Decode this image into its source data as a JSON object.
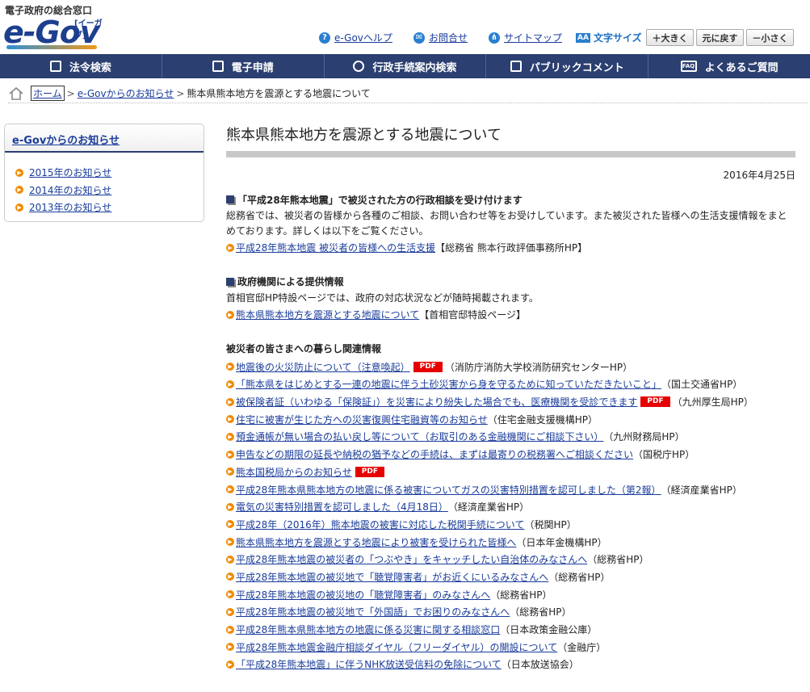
{
  "header": {
    "tagline": "電子政府の総合窓口",
    "logo_text": "e-Gov",
    "logo_kana": "[イーガブ]",
    "util_links": [
      {
        "label": "e-Govヘルプ",
        "icon": "question-icon"
      },
      {
        "label": "お問合せ",
        "icon": "mail-icon"
      },
      {
        "label": "サイトマップ",
        "icon": "sitemap-icon"
      }
    ],
    "font_size_label": "文字サイズ",
    "font_size_icon_text": "AA",
    "font_size_buttons": [
      "＋大きく",
      "元に戻す",
      "－小さく"
    ]
  },
  "nav": {
    "items": [
      "法令検索",
      "電子申請",
      "行政手続案内検索",
      "パブリックコメント",
      "よくあるご質問"
    ]
  },
  "breadcrumb": {
    "home": "ホーム",
    "parent": "e-Govからのお知らせ",
    "current": "熊本県熊本地方を震源とする地震について",
    "sep": ">"
  },
  "sidebar": {
    "heading": "e-Govからのお知らせ",
    "items": [
      "2015年のお知らせ",
      "2014年のお知らせ",
      "2013年のお知らせ"
    ]
  },
  "main": {
    "title": "熊本県熊本地方を震源とする地震について",
    "date": "2016年4月25日",
    "section1": {
      "heading": "「平成28年熊本地震」で被災された方の行政相談を受け付けます",
      "text": "総務省では、被災者の皆様から各種のご相談、お問い合わせ等をお受けしています。また被災された皆様への生活支援情報をまとめております。詳しくは以下をご覧ください。",
      "link": "平成28年熊本地震 被災者の皆様への生活支援",
      "note": "【総務省 熊本行政評価事務所HP】"
    },
    "section2": {
      "heading": "政府機関による提供情報",
      "text": "首相官邸HP特設ページでは、政府の対応状況などが随時掲載されます。",
      "link": "熊本県熊本地方を震源とする地震について",
      "note": "【首相官邸特設ページ】"
    },
    "section3": {
      "heading": "被災者の皆さまへの暮らし関連情報",
      "pdf_label": "PDF",
      "links": [
        {
          "text": "地震後の火災防止について（注意喚起）",
          "pdf": true,
          "note": "（消防庁消防大学校消防研究センターHP）"
        },
        {
          "text": "「熊本県をはじめとする一連の地震に伴う土砂災害から身を守るために知っていただきたいこと」",
          "pdf": false,
          "note": "（国土交通省HP）"
        },
        {
          "text": "被保険者証（いわゆる「保険証」）を災害により紛失した場合でも、医療機関を受診できます",
          "pdf": true,
          "note": "（九州厚生局HP）"
        },
        {
          "text": "住宅に被害が生じた方への災害復興住宅融資等のお知らせ",
          "pdf": false,
          "note": "（住宅金融支援機構HP）"
        },
        {
          "text": "預金通帳が無い場合の払い戻し等について（お取引のある金融機関にご相談下さい）",
          "pdf": false,
          "note": "（九州財務局HP）"
        },
        {
          "text": "申告などの期限の延長や納税の猶予などの手続は、まずは最寄りの税務署へご相談ください",
          "pdf": false,
          "note": "（国税庁HP）"
        },
        {
          "text": "熊本国税局からのお知らせ",
          "pdf": true,
          "note": ""
        },
        {
          "text": "平成28年熊本県熊本地方の地震に係る被害についてガスの災害特別措置を認可しました（第2報）",
          "pdf": false,
          "note": "（経済産業省HP）"
        },
        {
          "text": "電気の災害特別措置を認可しました（4月18日）",
          "pdf": false,
          "note": "（経済産業省HP）"
        },
        {
          "text": "平成28年（2016年）熊本地震の被害に対応した税関手続について",
          "pdf": false,
          "note": "（税関HP）"
        },
        {
          "text": "熊本県熊本地方を震源とする地震により被害を受けられた皆様へ",
          "pdf": false,
          "note": "（日本年金機構HP）"
        },
        {
          "text": "平成28年熊本地震の被災者の「つぶやき」をキャッチしたい自治体のみなさんへ",
          "pdf": false,
          "note": "（総務省HP）"
        },
        {
          "text": "平成28年熊本地震の被災地で「聴覚障害者」がお近くにいるみなさんへ",
          "pdf": false,
          "note": "（総務省HP）"
        },
        {
          "text": "平成28年熊本地震の被災地の「聴覚障害者」のみなさんへ",
          "pdf": false,
          "note": "（総務省HP）"
        },
        {
          "text": "平成28年熊本地震の被災地で「外国語」でお困りのみなさんへ",
          "pdf": false,
          "note": "（総務省HP）"
        },
        {
          "text": "平成28年熊本県熊本地方の地震に係る災害に関する相談窓口",
          "pdf": false,
          "note": "（日本政策金融公庫）"
        },
        {
          "text": "平成28年熊本地震金融庁相談ダイヤル（フリーダイヤル）の開設について",
          "pdf": false,
          "note": "（金融庁）"
        },
        {
          "text": "「平成28年熊本地震」に伴うNHK放送受信料の免除について",
          "pdf": false,
          "note": "（日本放送協会）"
        }
      ]
    }
  }
}
